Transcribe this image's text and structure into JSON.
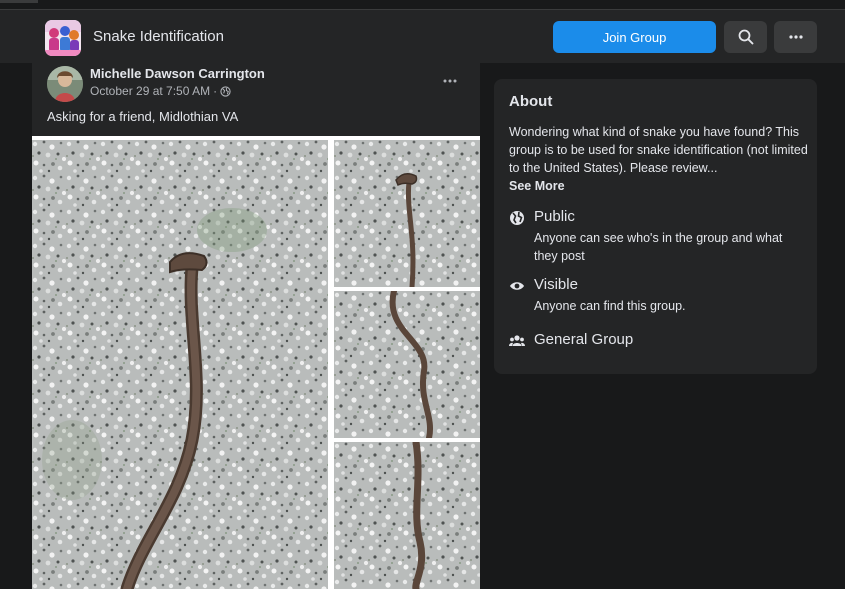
{
  "header": {
    "group_title": "Snake Identification",
    "join_label": "Join Group",
    "search_icon": "search-icon",
    "more_icon": "more-horizontal-icon"
  },
  "post": {
    "author": "Michelle Dawson Carrington",
    "timestamp": "October 29 at 7:50 AM",
    "separator": "·",
    "privacy_icon": "globe-icon",
    "text": "Asking for a friend, Midlothian VA",
    "photo_count": 4
  },
  "about": {
    "title": "About",
    "description": "Wondering what kind of snake you have found? This group is to be used for snake identification (not limited to the United States). Please review...",
    "see_more": "See More",
    "items": [
      {
        "icon": "globe-icon",
        "title": "Public",
        "subtitle": "Anyone can see who's in the group and what they post"
      },
      {
        "icon": "eye-icon",
        "title": "Visible",
        "subtitle": "Anyone can find this group."
      },
      {
        "icon": "people-icon",
        "title": "General Group",
        "subtitle": ""
      }
    ]
  },
  "colors": {
    "background": "#18191a",
    "card": "#242526",
    "accent": "#1b8cea",
    "text": "#e4e6eb",
    "secondary_text": "#b0b3b8"
  }
}
